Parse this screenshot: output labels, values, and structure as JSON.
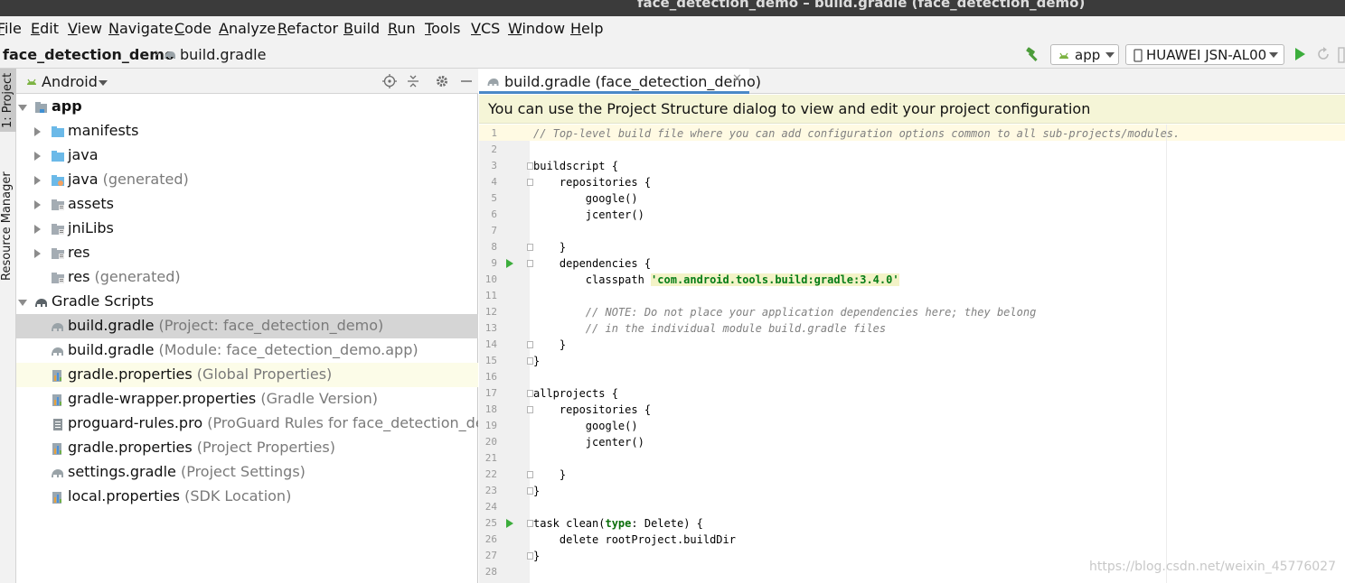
{
  "window": {
    "title": "face_detection_demo – build.gradle (face_detection_demo)"
  },
  "menu": [
    "File",
    "Edit",
    "View",
    "Navigate",
    "Code",
    "Analyze",
    "Refactor",
    "Build",
    "Run",
    "Tools",
    "VCS",
    "Window",
    "Help"
  ],
  "navbar": {
    "project": "face_detection_demo",
    "file": "build.gradle",
    "run_config": "app",
    "device": "HUAWEI JSN-AL00"
  },
  "stripe": {
    "project_tab": "1: Project",
    "resource_tab": "Resource Manager"
  },
  "project_panel": {
    "view_mode": "Android",
    "tree": [
      {
        "name": "app",
        "hint": "",
        "toggle": "open",
        "depth": 0,
        "icon": "module-folder-icon"
      },
      {
        "name": "manifests",
        "hint": "",
        "toggle": "closed",
        "depth": 1,
        "icon": "folder-icon"
      },
      {
        "name": "java",
        "hint": "",
        "toggle": "closed",
        "depth": 1,
        "icon": "folder-icon"
      },
      {
        "name": "java",
        "hint": " (generated)",
        "toggle": "closed",
        "depth": 1,
        "icon": "generated-folder-icon"
      },
      {
        "name": "assets",
        "hint": "",
        "toggle": "closed",
        "depth": 1,
        "icon": "resource-folder-icon"
      },
      {
        "name": "jniLibs",
        "hint": "",
        "toggle": "closed",
        "depth": 1,
        "icon": "resource-folder-icon"
      },
      {
        "name": "res",
        "hint": "",
        "toggle": "closed",
        "depth": 1,
        "icon": "resource-folder-icon"
      },
      {
        "name": "res",
        "hint": " (generated)",
        "toggle": "none",
        "depth": 1,
        "icon": "resource-folder-icon"
      },
      {
        "name": "Gradle Scripts",
        "hint": "",
        "toggle": "open",
        "depth": 0,
        "icon": "gradle-icon"
      },
      {
        "name": "build.gradle",
        "hint": " (Project: face_detection_demo)",
        "toggle": "none",
        "depth": 1,
        "icon": "gradle-file-icon",
        "state": "selected"
      },
      {
        "name": "build.gradle",
        "hint": " (Module: face_detection_demo.app)",
        "toggle": "none",
        "depth": 1,
        "icon": "gradle-file-icon"
      },
      {
        "name": "gradle.properties",
        "hint": " (Global Properties)",
        "toggle": "none",
        "depth": 1,
        "icon": "properties-file-icon",
        "state": "hover"
      },
      {
        "name": "gradle-wrapper.properties",
        "hint": " (Gradle Version)",
        "toggle": "none",
        "depth": 1,
        "icon": "properties-file-icon"
      },
      {
        "name": "proguard-rules.pro",
        "hint": " (ProGuard Rules for face_detection_demo.app)",
        "toggle": "none",
        "depth": 1,
        "icon": "text-file-icon"
      },
      {
        "name": "gradle.properties",
        "hint": " (Project Properties)",
        "toggle": "none",
        "depth": 1,
        "icon": "properties-file-icon"
      },
      {
        "name": "settings.gradle",
        "hint": " (Project Settings)",
        "toggle": "none",
        "depth": 1,
        "icon": "gradle-file-icon"
      },
      {
        "name": "local.properties",
        "hint": " (SDK Location)",
        "toggle": "none",
        "depth": 1,
        "icon": "properties-file-icon"
      }
    ]
  },
  "editor": {
    "tab_label": "build.gradle (face_detection_demo)",
    "banner": "You can use the Project Structure dialog to view and edit your project configuration",
    "lines": [
      {
        "n": "1",
        "text": "// Top-level build file where you can add configuration options common to all sub-projects/modules.",
        "comment": true
      },
      {
        "n": "2",
        "text": ""
      },
      {
        "n": "3",
        "text": "buildscript {",
        "fold": true
      },
      {
        "n": "4",
        "text": "    repositories {",
        "fold": true
      },
      {
        "n": "5",
        "text": "        google()"
      },
      {
        "n": "6",
        "text": "        jcenter()"
      },
      {
        "n": "7",
        "text": ""
      },
      {
        "n": "8",
        "text": "    }",
        "fold": true
      },
      {
        "n": "9",
        "text": "    dependencies {",
        "fold": true,
        "run": true
      },
      {
        "n": "10",
        "text": "        classpath ",
        "str": "'com.android.tools.build:gradle:3.4.0'"
      },
      {
        "n": "11",
        "text": ""
      },
      {
        "n": "12",
        "text": "        // NOTE: Do not place your application dependencies here; they belong",
        "comment": true
      },
      {
        "n": "13",
        "text": "        // in the individual module build.gradle files",
        "comment": true
      },
      {
        "n": "14",
        "text": "    }",
        "fold": true
      },
      {
        "n": "15",
        "text": "}",
        "fold": true
      },
      {
        "n": "16",
        "text": ""
      },
      {
        "n": "17",
        "text": "allprojects {",
        "fold": true
      },
      {
        "n": "18",
        "text": "    repositories {",
        "fold": true
      },
      {
        "n": "19",
        "text": "        google()"
      },
      {
        "n": "20",
        "text": "        jcenter()"
      },
      {
        "n": "21",
        "text": ""
      },
      {
        "n": "22",
        "text": "    }",
        "fold": true
      },
      {
        "n": "23",
        "text": "}",
        "fold": true
      },
      {
        "n": "24",
        "text": ""
      },
      {
        "n": "25",
        "text": "task clean(",
        "kw": "type",
        "rest": ": Delete) {",
        "fold": true,
        "run": true
      },
      {
        "n": "26",
        "text": "    delete rootProject.buildDir"
      },
      {
        "n": "27",
        "text": "}",
        "fold": true
      },
      {
        "n": "28",
        "text": ""
      }
    ]
  },
  "watermark": "https://blog.csdn.net/weixin_45776027",
  "colors": {
    "accent": "#4a88c7",
    "run_green": "#3cad3c",
    "string_green": "#067d17",
    "selection": "#d5d5d5",
    "banner": "#f5f5d7"
  }
}
